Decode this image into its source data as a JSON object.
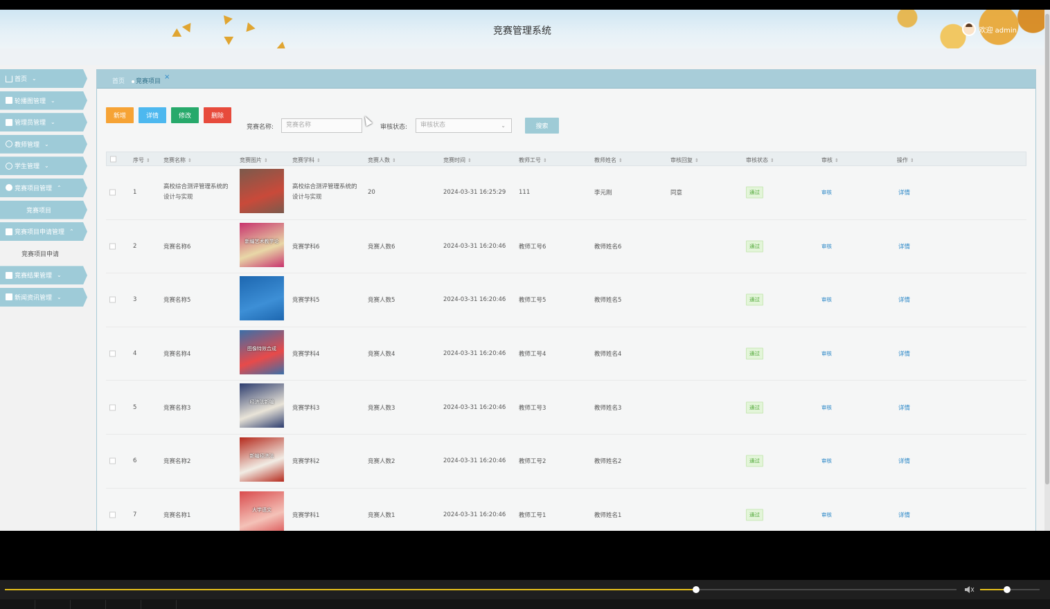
{
  "header": {
    "title": "竞赛管理系统",
    "welcome": "欢迎 admin"
  },
  "sidebar": {
    "items": [
      {
        "label": "首页",
        "icon": "home-icon"
      },
      {
        "label": "轮播图管理",
        "icon": "image-icon"
      },
      {
        "label": "管理员管理",
        "icon": "admin-icon"
      },
      {
        "label": "教师管理",
        "icon": "user-icon"
      },
      {
        "label": "学生管理",
        "icon": "student-icon"
      },
      {
        "label": "竞赛项目管理",
        "icon": "competition-icon"
      }
    ],
    "sub_active": "竞赛项目",
    "item_apply": {
      "label": "竞赛项目申请管理",
      "icon": "grid-icon"
    },
    "sub_apply": "竞赛项目申请",
    "item_result": {
      "label": "竞赛结果管理",
      "icon": "result-icon"
    },
    "item_news": {
      "label": "新闻资讯管理",
      "icon": "news-icon"
    }
  },
  "tabs": {
    "home": "首页",
    "current": "竞赛项目",
    "close": "×"
  },
  "toolbar": {
    "add": "新增",
    "detail": "详情",
    "edit": "修改",
    "delete": "删除"
  },
  "search": {
    "name_label": "竞赛名称:",
    "name_placeholder": "竞赛名称",
    "status_label": "审核状态:",
    "status_placeholder": "审核状态",
    "button": "搜索"
  },
  "table": {
    "columns": [
      "序号",
      "竞赛名称",
      "竞赛图片",
      "竞赛学科",
      "竞赛人数",
      "竞赛时间",
      "教师工号",
      "教师姓名",
      "审核回复",
      "审核状态",
      "审核",
      "操作"
    ],
    "rows": [
      {
        "no": "1",
        "name": "高校综合测评管理系统的设计与实现",
        "subject": "高校综合测评管理系统的设计与实现",
        "count": "20",
        "time": "2024-03-31 16:25:29",
        "tid": "111",
        "tname": "李元刚",
        "reply": "同意",
        "status": "通过",
        "review": "审核",
        "op": "详情"
      },
      {
        "no": "2",
        "name": "竞赛名称6",
        "subject": "竞赛学科6",
        "count": "竞赛人数6",
        "time": "2024-03-31 16:20:46",
        "tid": "教师工号6",
        "tname": "教师姓名6",
        "reply": "",
        "status": "通过",
        "review": "审核",
        "op": "详情"
      },
      {
        "no": "3",
        "name": "竞赛名称5",
        "subject": "竞赛学科5",
        "count": "竞赛人数5",
        "time": "2024-03-31 16:20:46",
        "tid": "教师工号5",
        "tname": "教师姓名5",
        "reply": "",
        "status": "通过",
        "review": "审核",
        "op": "详情"
      },
      {
        "no": "4",
        "name": "竞赛名称4",
        "subject": "竞赛学科4",
        "count": "竞赛人数4",
        "time": "2024-03-31 16:20:46",
        "tid": "教师工号4",
        "tname": "教师姓名4",
        "reply": "",
        "status": "通过",
        "review": "审核",
        "op": "详情"
      },
      {
        "no": "5",
        "name": "竞赛名称3",
        "subject": "竞赛学科3",
        "count": "竞赛人数3",
        "time": "2024-03-31 16:20:46",
        "tid": "教师工号3",
        "tname": "教师姓名3",
        "reply": "",
        "status": "通过",
        "review": "审核",
        "op": "详情"
      },
      {
        "no": "6",
        "name": "竞赛名称2",
        "subject": "竞赛学科2",
        "count": "竞赛人数2",
        "time": "2024-03-31 16:20:46",
        "tid": "教师工号2",
        "tname": "教师姓名2",
        "reply": "",
        "status": "通过",
        "review": "审核",
        "op": "详情"
      },
      {
        "no": "7",
        "name": "竞赛名称1",
        "subject": "竞赛学科1",
        "count": "竞赛人数1",
        "time": "2024-03-31 16:20:46",
        "tid": "教师工号1",
        "tname": "教师姓名1",
        "reply": "",
        "status": "通过",
        "review": "审核",
        "op": "详情"
      }
    ],
    "thumbnails": [
      {
        "bg": "#7b5a4c",
        "fg": "#c94a3a",
        "text": ""
      },
      {
        "bg": "#c8336d",
        "fg": "#e8d7a7",
        "text": "新编艺术教学论"
      },
      {
        "bg": "#1d67b0",
        "fg": "#3d8fd6",
        "text": ""
      },
      {
        "bg": "#3a6fa8",
        "fg": "#e84a4a",
        "text": "图像特效合成"
      },
      {
        "bg": "#2c3c6e",
        "fg": "#e9e4d8",
        "text": "经济法新编"
      },
      {
        "bg": "#b52a1d",
        "fg": "#f1ece4",
        "text": "新编经济法"
      },
      {
        "bg": "#d94b4d",
        "fg": "#f4c2b8",
        "text": "大学语文"
      }
    ]
  },
  "player": {
    "progress": 0.726,
    "volume": 0.45
  }
}
